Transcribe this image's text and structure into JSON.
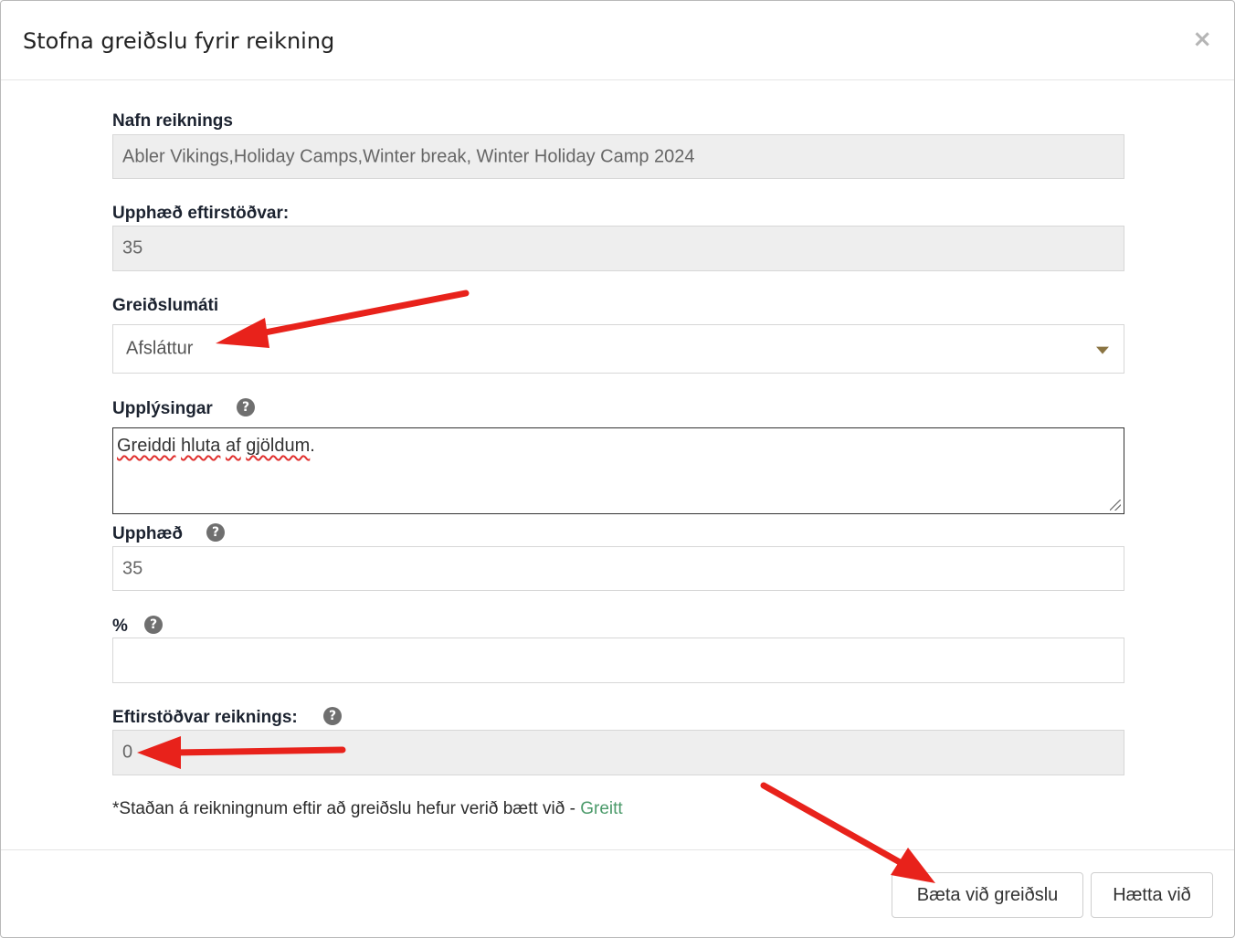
{
  "modal": {
    "title": "Stofna greiðslu fyrir reikning",
    "close_symbol": "×"
  },
  "form": {
    "invoice_name": {
      "label": "Nafn reiknings",
      "value": "Abler Vikings,Holiday Camps,Winter break, Winter Holiday Camp 2024"
    },
    "remaining_amount": {
      "label": "Upphæð eftirstöðvar:",
      "value": "35"
    },
    "payment_method": {
      "label": "Greiðslumáti",
      "selected": "Afsláttur"
    },
    "information": {
      "label": "Upplýsingar",
      "help": "?",
      "words": [
        "Greiddi",
        "hluta",
        "af",
        "gjöldum"
      ],
      "trailing": "."
    },
    "amount": {
      "label": "Upphæð",
      "help": "?",
      "value": "35"
    },
    "percent": {
      "label": "%",
      "help": "?",
      "value": ""
    },
    "invoice_balance": {
      "label": "Eftirstöðvar reiknings:",
      "help": "?",
      "value": "0"
    }
  },
  "note": {
    "text": "*Staðan á reikningnum eftir að greiðslu hefur verið bætt við - ",
    "status": "Greitt"
  },
  "footer": {
    "add_payment": "Bæta við greiðslu",
    "cancel": "Hætta við"
  },
  "colors": {
    "annotation_arrow": "#e8221b",
    "status_green": "#4b9a6a",
    "caret": "#8a7442"
  },
  "annotations": [
    "arrow-to-payment-method",
    "arrow-to-invoice-balance",
    "arrow-to-add-payment-button"
  ]
}
